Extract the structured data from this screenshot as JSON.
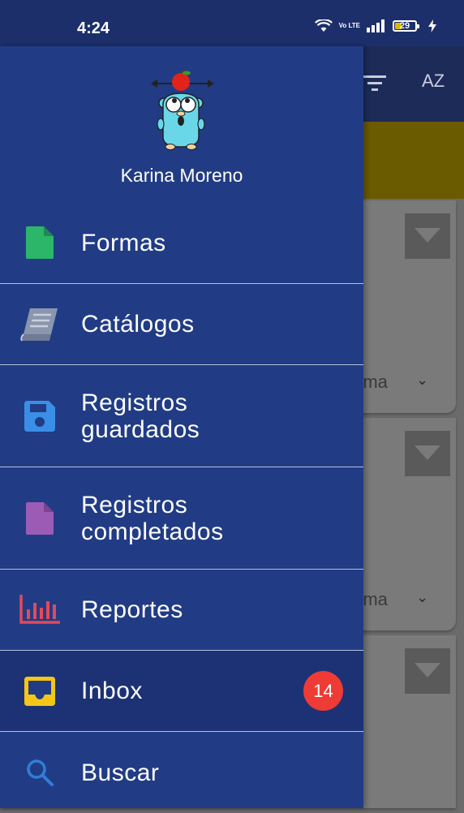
{
  "status_bar": {
    "time": "4:24",
    "network_label": "Vo LTE",
    "battery": "29",
    "icons": [
      "wifi-icon",
      "volte-icon",
      "signal-icon",
      "battery-icon",
      "charging-icon"
    ]
  },
  "background": {
    "toolbar_icons": [
      "filter-icon",
      "sort-az-icon"
    ],
    "sort_label": "AZ",
    "cards": [
      {
        "partial_text": "rma"
      },
      {
        "partial_text": "rma"
      },
      {
        "partial_text": ""
      }
    ]
  },
  "drawer": {
    "user_name": "Karina Moreno",
    "avatar_icon": "gopher-avatar-icon",
    "items": [
      {
        "label": "Formas",
        "icon": "document-icon",
        "icon_color": "#2bb66a"
      },
      {
        "label": "Catálogos",
        "icon": "book-icon",
        "icon_color": "#8a96ae"
      },
      {
        "label": "Registros\nguardados",
        "icon": "save-icon",
        "icon_color": "#3a8ee6"
      },
      {
        "label": "Registros\ncompletados",
        "icon": "document-icon",
        "icon_color": "#9c5cb6"
      },
      {
        "label": "Reportes",
        "icon": "bar-chart-icon",
        "icon_color": "#e24a5a"
      },
      {
        "label": "Inbox",
        "icon": "inbox-icon",
        "icon_color": "#f5c518",
        "badge": "14",
        "active": true
      },
      {
        "label": "Buscar",
        "icon": "search-icon",
        "icon_color": "#2e7fd8"
      }
    ]
  },
  "colors": {
    "status_bar": "#1c2f6b",
    "drawer_bg": "#213c85",
    "badge": "#ef3b36",
    "divider": "#b7c0dc"
  }
}
